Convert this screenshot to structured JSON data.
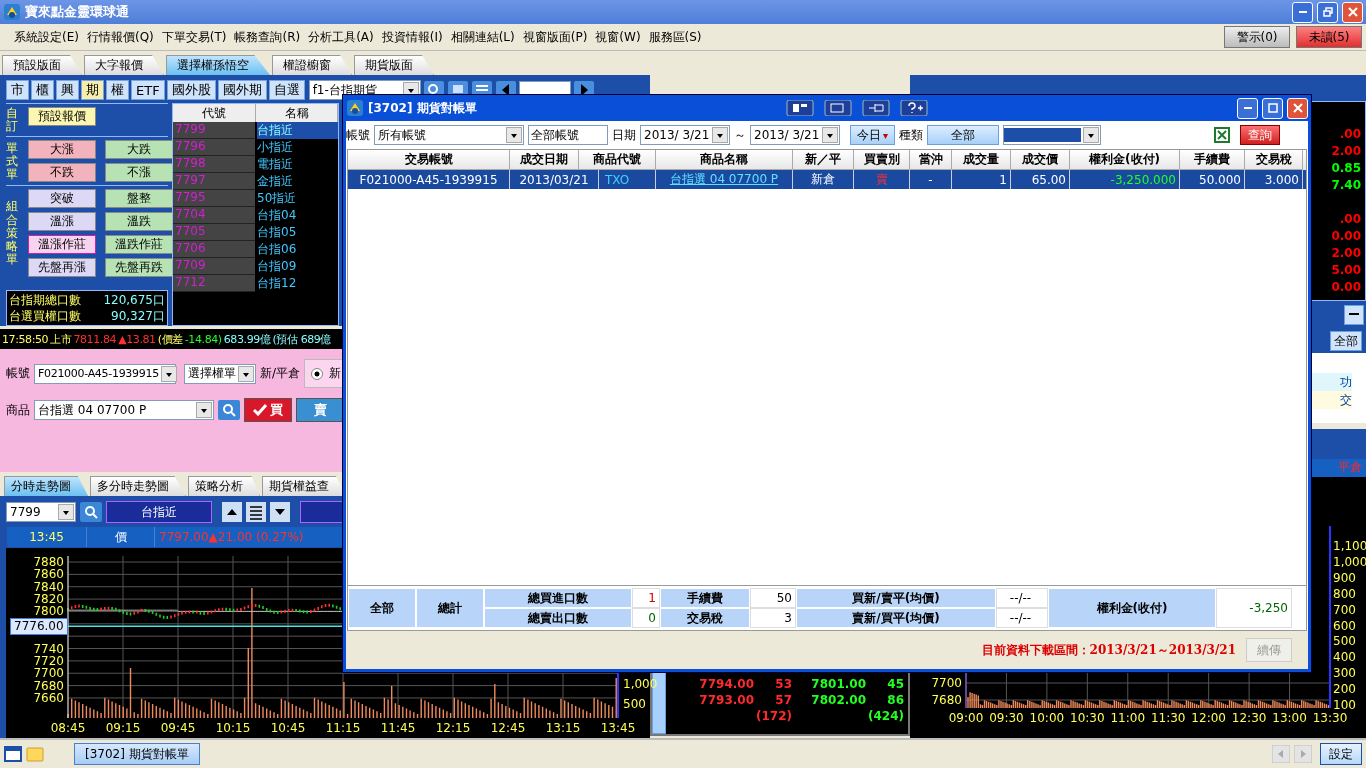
{
  "window": {
    "title": "寶來點金靈環球通"
  },
  "menu": {
    "items": [
      "系統設定(E)",
      "行情報價(Q)",
      "下單交易(T)",
      "帳務查詢(R)",
      "分析工具(A)",
      "投資情報(I)",
      "相關連結(L)",
      "視窗版面(P)",
      "視窗(W)",
      "服務區(S)"
    ],
    "alerts": [
      {
        "label": "警示(0)",
        "kind": "plain"
      },
      {
        "label": "未讀(5)",
        "kind": "alert"
      }
    ]
  },
  "layout_tabs": [
    {
      "label": "預設版面",
      "selected": false
    },
    {
      "label": "大字報價",
      "selected": false
    },
    {
      "label": "選擇權孫悟空",
      "selected": true
    },
    {
      "label": "權證櫥窗",
      "selected": false
    },
    {
      "label": "期貨版面",
      "selected": false
    }
  ],
  "market_bar": {
    "buttons": [
      {
        "label": "市",
        "selected": false
      },
      {
        "label": "櫃",
        "selected": false
      },
      {
        "label": "興",
        "selected": false
      },
      {
        "label": "期",
        "selected": true
      },
      {
        "label": "權",
        "selected": false
      },
      {
        "label": "ETF",
        "selected": false
      },
      {
        "label": "國外股",
        "selected": false
      },
      {
        "label": "國外期",
        "selected": false
      },
      {
        "label": "自選",
        "selected": false
      }
    ],
    "product": "f1-台指期貨"
  },
  "strategy_panel": {
    "groups": [
      {
        "label": "自訂",
        "buttons": [
          {
            "label": "預設報價",
            "kind": "default"
          }
        ]
      },
      {
        "label": "單式單",
        "buttons": [
          {
            "label": "大漲",
            "kind": "rise"
          },
          {
            "label": "大跌",
            "kind": "fall"
          },
          {
            "label": "不跌",
            "kind": "rise"
          },
          {
            "label": "不漲",
            "kind": "fall"
          }
        ]
      },
      {
        "label": "組合策略單",
        "buttons": [
          {
            "label": "突破",
            "kind": "neutral"
          },
          {
            "label": "盤整",
            "kind": "fall"
          },
          {
            "label": "溫漲",
            "kind": "neutral"
          },
          {
            "label": "溫跌",
            "kind": "fall"
          },
          {
            "label": "溫漲作莊",
            "kind": "focus"
          },
          {
            "label": "溫跌作莊",
            "kind": "fall"
          },
          {
            "label": "先盤再漲",
            "kind": "neutral"
          },
          {
            "label": "先盤再跌",
            "kind": "fall"
          }
        ]
      }
    ],
    "stats": [
      {
        "label": "台指期總口數",
        "value": "120,675口"
      },
      {
        "label": "台選買權口數",
        "value": "90,327口"
      }
    ]
  },
  "quote_list": {
    "columns": [
      "代號",
      "名稱"
    ],
    "rows": [
      {
        "code": "7799",
        "name": "台指近",
        "selected": true
      },
      {
        "code": "7796",
        "name": "小指近",
        "selected": false
      },
      {
        "code": "7798",
        "name": "電指近",
        "selected": false
      },
      {
        "code": "7797",
        "name": "金指近",
        "selected": false
      },
      {
        "code": "7795",
        "name": "50指近",
        "selected": false
      },
      {
        "code": "7704",
        "name": "台指04",
        "selected": false
      },
      {
        "code": "7705",
        "name": "台指05",
        "selected": false
      },
      {
        "code": "7706",
        "name": "台指06",
        "selected": false
      },
      {
        "code": "7709",
        "name": "台指09",
        "selected": false
      },
      {
        "code": "7712",
        "name": "台指12",
        "selected": false
      }
    ]
  },
  "ticker": {
    "time": "17:58:50",
    "market": "上市",
    "index": "7811.84",
    "change": "▲13.81",
    "spread_label": "(價差",
    "spread": "-14.84)",
    "amount": "683.99億",
    "estimate": "(預估 689億"
  },
  "order_form": {
    "account_label": "帳號",
    "account": "F021000-A45-1939915",
    "order_type": "選擇權單",
    "position_label": "新/平倉",
    "position_options": [
      {
        "label": "新",
        "selected": true
      }
    ],
    "product_label": "商品",
    "product": "台指選 04 07700 P",
    "buy": {
      "label": "買",
      "selected": true
    },
    "sell": {
      "label": "賣",
      "selected": false
    }
  },
  "chart_tabs": [
    {
      "label": "分時走勢圖",
      "selected": true
    },
    {
      "label": "多分時走勢圖",
      "selected": false
    },
    {
      "label": "策略分析",
      "selected": false
    },
    {
      "label": "期貨權益查",
      "selected": false
    }
  ],
  "chart": {
    "symbol": "7799",
    "name": "台指近",
    "time": "13:45",
    "price_label": "價",
    "price": "7797.00▲21.00 (0.27%)",
    "marker": "7776.00",
    "yticks": [
      "7880",
      "7860",
      "7840",
      "7820",
      "7800",
      "7740",
      "7720",
      "7700",
      "7680",
      "7660"
    ],
    "volume_ticks": [
      "1,000",
      "500"
    ],
    "xticks": [
      "08:45",
      "09:15",
      "09:45",
      "10:15",
      "10:45",
      "11:15",
      "11:45",
      "12:15",
      "12:45",
      "13:15",
      "13:45"
    ]
  },
  "depth": {
    "rows": [
      {
        "bid": "7794.00",
        "bid_qty": "53",
        "ask": "7801.00",
        "ask_qty": "45"
      },
      {
        "bid": "7793.00",
        "bid_qty": "57",
        "ask": "7802.00",
        "ask_qty": "86"
      }
    ],
    "bid_total": "(172)",
    "ask_total": "(424)"
  },
  "right_panel": {
    "values": [
      {
        "text": ".00",
        "color": "#ff0000"
      },
      {
        "text": "2.00",
        "color": "#ff0000"
      },
      {
        "text": "0.85",
        "color": "#00ff00"
      },
      {
        "text": "7.40",
        "color": "#00ff00"
      },
      {
        "text": ".00",
        "color": "#ff0000"
      },
      {
        "text": "0.00",
        "color": "#ff0000"
      },
      {
        "text": "2.00",
        "color": "#ff0000"
      },
      {
        "text": "5.00",
        "color": "#ff0000"
      },
      {
        "text": "0.00",
        "color": "#ff0000"
      }
    ],
    "filter_button": "全部",
    "list": [
      "功",
      "交"
    ],
    "header": "平倉"
  },
  "right_chart": {
    "yticks": [
      "7700",
      "7680"
    ],
    "volume_ticks": [
      "1,100",
      "1,000",
      "900",
      "800",
      "700",
      "600",
      "500",
      "400",
      "300",
      "200",
      "100"
    ],
    "xticks": [
      "09:00",
      "09:30",
      "10:00",
      "10:30",
      "11:00",
      "11:30",
      "12:00",
      "12:30",
      "13:00",
      "13:30"
    ]
  },
  "dialog": {
    "title": "[3702] 期貨對帳單",
    "filters": {
      "account_label": "帳號",
      "account": "所有帳號",
      "account_name": "全部帳號",
      "date_label": "日期",
      "date_from": "2013/ 3/21",
      "separator": "～",
      "date_to": "2013/ 3/21",
      "today": "今日",
      "today_caret": "▾",
      "type_label": "種類",
      "type": "全部",
      "query": "查詢"
    },
    "columns": [
      "交易帳號",
      "成交日期",
      "商品代號",
      "商品名稱",
      "新／平",
      "買賣別",
      "當沖",
      "成交量",
      "成交價",
      "權利金(收付)",
      "手續費",
      "交易稅"
    ],
    "rows": [
      {
        "selected": true,
        "cells": [
          "F021000-A45-1939915",
          "2013/03/21",
          "TXO",
          "台指選 04 07700 P",
          "新倉",
          "賣",
          "-",
          "1",
          "65.00",
          "-3,250.000",
          "50.000",
          "3.000"
        ]
      }
    ],
    "summary": {
      "scope": "全部",
      "total": "總計",
      "buy_label": "總買進口數",
      "buy": "1",
      "sell_label": "總賣出口數",
      "sell": "0",
      "fee_label": "手續費",
      "fee": "50",
      "tax_label": "交易稅",
      "tax": "3",
      "long_label": "買新/賣平(均價)",
      "long": "--/--",
      "short_label": "賣新/買平(均價)",
      "short": "--/--",
      "premium_label": "權利金(收付)",
      "premium": "-3,250"
    },
    "range": "目前資料下載區間：2013/3/21～2013/3/21",
    "resume": {
      "label": "續傳",
      "disabled": true
    }
  },
  "taskbar": {
    "task": "[3702] 期貨對帳單",
    "settings": "設定"
  }
}
